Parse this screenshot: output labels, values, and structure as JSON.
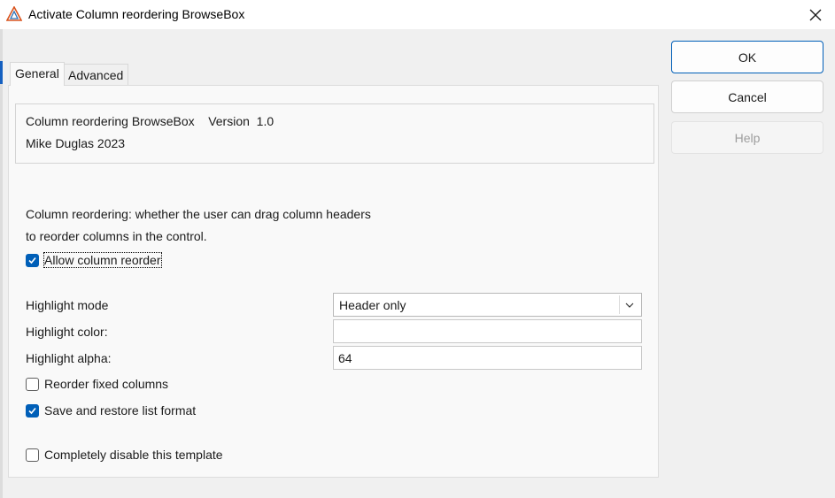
{
  "window": {
    "title": "Activate Column reordering BrowseBox",
    "app_icon": "warning-triangle-icon",
    "close_icon": "close-icon"
  },
  "tabs": [
    {
      "label": "General",
      "active": true
    },
    {
      "label": "Advanced",
      "active": false
    }
  ],
  "info": {
    "line1": "Column reordering BrowseBox    Version  1.0",
    "line2": "Mike Duglas 2023"
  },
  "description": {
    "line1": "Column reordering: whether the user can drag column headers",
    "line2": "to reorder columns in the control."
  },
  "options": {
    "allow_reorder": {
      "label": "Allow column reorder",
      "checked": true
    },
    "reorder_fixed": {
      "label": "Reorder fixed columns",
      "checked": false
    },
    "save_restore": {
      "label": "Save and restore list format",
      "checked": true
    },
    "disable_template": {
      "label": "Completely disable this template",
      "checked": false
    }
  },
  "fields": {
    "highlight_mode": {
      "label": "Highlight mode",
      "value": "Header only"
    },
    "highlight_color": {
      "label": "Highlight color:",
      "value": ""
    },
    "highlight_alpha": {
      "label": "Highlight alpha:",
      "value": "64"
    }
  },
  "buttons": {
    "ok": "OK",
    "cancel": "Cancel",
    "help": "Help"
  },
  "colors": {
    "accent": "#005fb8",
    "disabled_text": "#9d9d9d"
  }
}
